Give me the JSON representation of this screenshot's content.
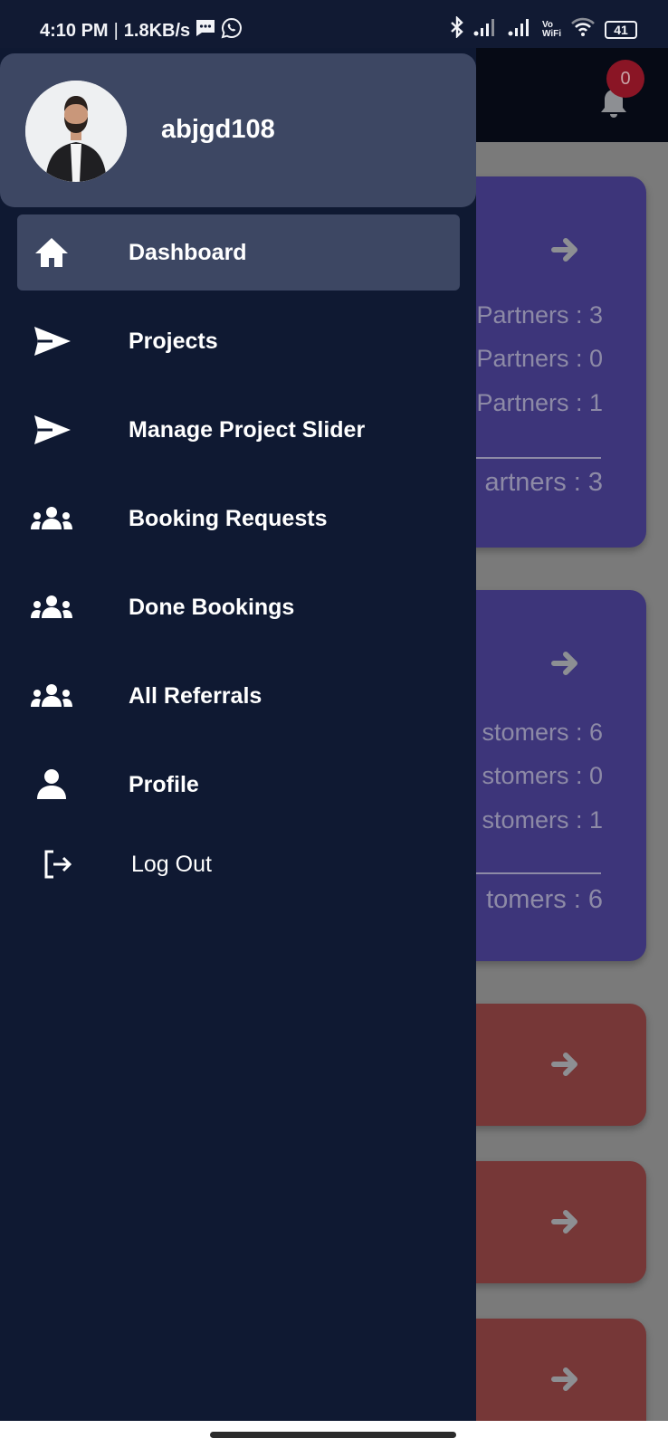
{
  "status_bar": {
    "time": "4:10 PM",
    "separator": "|",
    "net_speed": "1.8KB/s",
    "left_icons": [
      "message-icon",
      "whatsapp-icon"
    ],
    "right_icons": [
      "bluetooth-icon",
      "signal-sim1-icon",
      "signal-sim2-icon",
      "vowifi-icon",
      "wifi-icon",
      "battery-icon"
    ],
    "vowifi_top": "Vo",
    "vowifi_bottom": "WiFi",
    "battery_level": "41"
  },
  "background_app": {
    "notification_count": "0",
    "cards": [
      {
        "color": "#3d357a",
        "lines": [
          "Partners : 3",
          "Partners : 0",
          "Partners : 1"
        ],
        "total": "artners : 3"
      },
      {
        "color": "#3d357a",
        "lines": [
          "stomers : 6",
          "stomers : 0",
          "stomers : 1"
        ],
        "total": "tomers : 6"
      },
      {
        "color": "#763737"
      },
      {
        "color": "#763737"
      },
      {
        "color": "#763737"
      }
    ]
  },
  "drawer": {
    "username": "abjgd108",
    "items": [
      {
        "label": "Dashboard",
        "icon": "home-icon",
        "active": true
      },
      {
        "label": "Projects",
        "icon": "send-icon",
        "active": false
      },
      {
        "label": "Manage Project Slider",
        "icon": "send-icon",
        "active": false
      },
      {
        "label": "Booking Requests",
        "icon": "users-icon",
        "active": false
      },
      {
        "label": "Done Bookings",
        "icon": "users-icon",
        "active": false
      },
      {
        "label": "All Referrals",
        "icon": "users-icon",
        "active": false
      },
      {
        "label": "Profile",
        "icon": "user-icon",
        "active": false
      },
      {
        "label": "Log Out",
        "icon": "logout-icon",
        "active": false
      }
    ]
  },
  "colors": {
    "drawer_bg": "#0f1932",
    "active_item_bg": "#3d4763",
    "card_purple": "#3d357a",
    "card_red": "#763737",
    "badge_red": "#8a1525"
  }
}
